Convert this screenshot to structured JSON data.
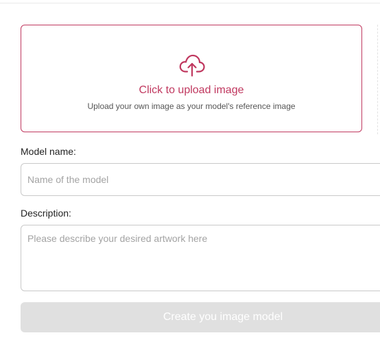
{
  "upload": {
    "title": "Click to upload image",
    "subtitle": "Upload your own image as your model's reference image",
    "icon": "cloud-upload-icon",
    "accent_color": "#c0385f"
  },
  "form": {
    "model_name": {
      "label": "Model name:",
      "value": "",
      "placeholder": "Name of the model"
    },
    "description": {
      "label": "Description:",
      "value": "",
      "placeholder": "Please describe your desired artwork here"
    },
    "submit": {
      "label": "Create you image model",
      "disabled": true
    }
  }
}
